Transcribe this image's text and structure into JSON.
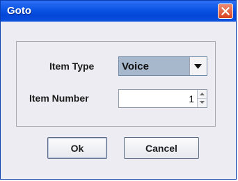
{
  "window": {
    "title": "Goto",
    "close_icon": "close-icon",
    "close_color": "#d8421f",
    "titlebar_color": "#0a54e4"
  },
  "form": {
    "item_type_label": "Item Type",
    "item_type_value": "Voice",
    "item_number_label": "Item Number",
    "item_number_value": "1"
  },
  "buttons": {
    "ok_label": "Ok",
    "cancel_label": "Cancel"
  },
  "icons": {
    "combo_arrow": "chevron-down-icon",
    "spin_up": "spin-up-icon",
    "spin_down": "spin-down-icon"
  }
}
